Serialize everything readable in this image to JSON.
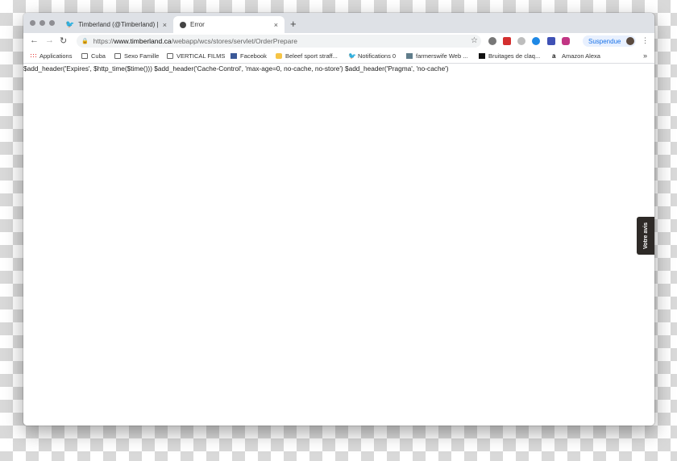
{
  "window": {
    "tabs": [
      {
        "title": "Timberland (@Timberland) | Tw",
        "icon": "twitter-icon"
      },
      {
        "title": "Error",
        "icon": "page-icon"
      }
    ],
    "close_glyph": "×",
    "new_tab_glyph": "+"
  },
  "toolbar": {
    "back_glyph": "←",
    "forward_glyph": "→",
    "reload_glyph": "↻",
    "url_scheme": "https://",
    "url_host": "www.timberland.ca",
    "url_path": "/webapp/wcs/stores/servlet/OrderPrepare",
    "bookmark_star_glyph": "☆",
    "profile_label": "Suspendue",
    "menu_glyph": "⋮"
  },
  "bookmarks": {
    "items": [
      {
        "label": "Applications",
        "icon": "apps-grid-icon"
      },
      {
        "label": "Cuba",
        "icon": "folder-icon"
      },
      {
        "label": "Sexo Famille",
        "icon": "folder-icon"
      },
      {
        "label": "VERTICAL FILMS",
        "icon": "folder-icon"
      },
      {
        "label": "Facebook",
        "icon": "facebook-icon"
      },
      {
        "label": "Beleef sport straff...",
        "icon": "smiley-icon"
      },
      {
        "label": "Notifications 0",
        "icon": "twitter-icon"
      },
      {
        "label": "farmerswife Web ...",
        "icon": "farmerswife-icon"
      },
      {
        "label": "Bruitages de claq...",
        "icon": "bruitages-icon"
      },
      {
        "label": "Amazon Alexa",
        "icon": "amazon-icon"
      }
    ],
    "more_glyph": "»"
  },
  "page": {
    "body_text": "$add_header('Expires', $http_time($time())) $add_header('Cache-Control', 'max-age=0, no-cache, no-store') $add_header('Pragma', 'no-cache')",
    "feedback_label": "Votre avis"
  },
  "colors": {
    "accent": "#1a73e8",
    "tabstrip": "#dee1e6",
    "feedback_tab": "#2e2a27"
  }
}
